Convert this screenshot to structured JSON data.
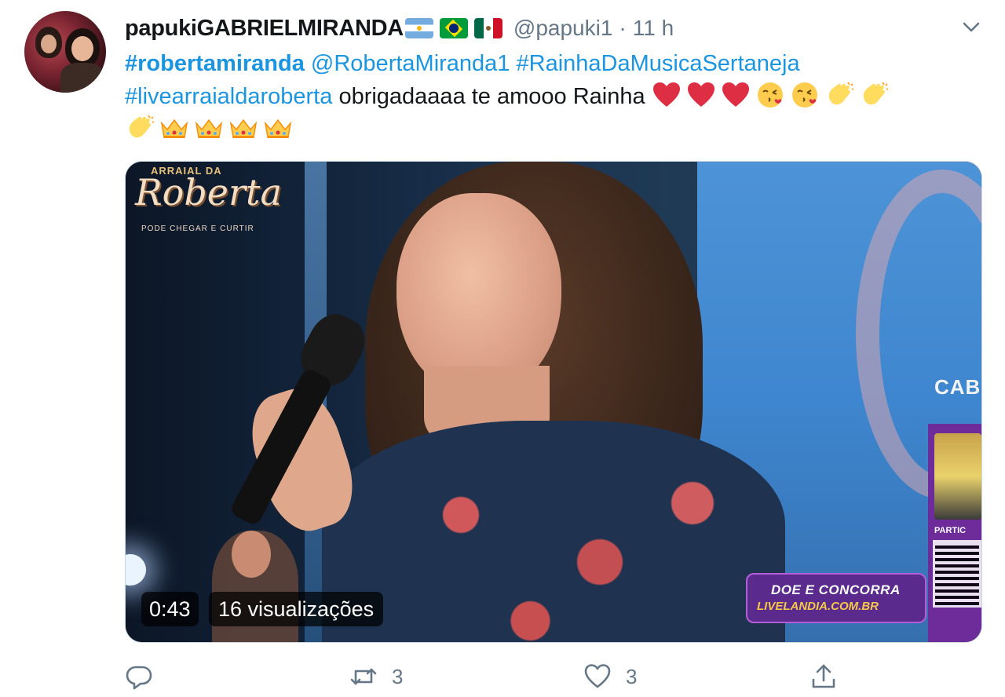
{
  "tweet": {
    "author_name": "papukiGABRIELMIRANDA",
    "flags": [
      "flag-argentina",
      "flag-brazil",
      "flag-mexico"
    ],
    "handle": "@papuki1",
    "separator": "·",
    "time": "11 h",
    "text": {
      "hashtag_1": "#robertamiranda",
      "mention": "@RobertaMiranda1",
      "hashtag_2": "#RainhaDaMusicaSertaneja",
      "hashtag_3": "#livearraialdaroberta",
      "body": "obrigadaaaa te amooo Rainha",
      "emojis_line2": [
        "heart-emoji",
        "heart-emoji",
        "heart-emoji",
        "kiss-face-emoji",
        "kiss-face-emoji",
        "clapping-hands-emoji",
        "clapping-hands-emoji"
      ],
      "emojis_line3": [
        "clapping-hands-emoji",
        "crown-emoji",
        "crown-emoji",
        "crown-emoji",
        "crown-emoji"
      ]
    },
    "media": {
      "duration": "0:43",
      "views": "16 visualizações",
      "overlay_logo_top": "ARRAIAL DA",
      "overlay_logo_name": "Roberta",
      "overlay_logo_tag": "PODE CHEGAR E CURTIR",
      "overlay_cab": "CABA",
      "overlay_doe_line1": "DOE E CONCORRA",
      "overlay_doe_line2": "LIVELANDIA.COM.BR",
      "overlay_partic": "PARTIC"
    },
    "actions": {
      "reply_count": "",
      "retweet_count": "3",
      "like_count": "3",
      "share_count": ""
    },
    "colors": {
      "link": "#1b95e0",
      "text": "#14171a",
      "secondary": "#657786",
      "heart": "#e0245e"
    }
  }
}
